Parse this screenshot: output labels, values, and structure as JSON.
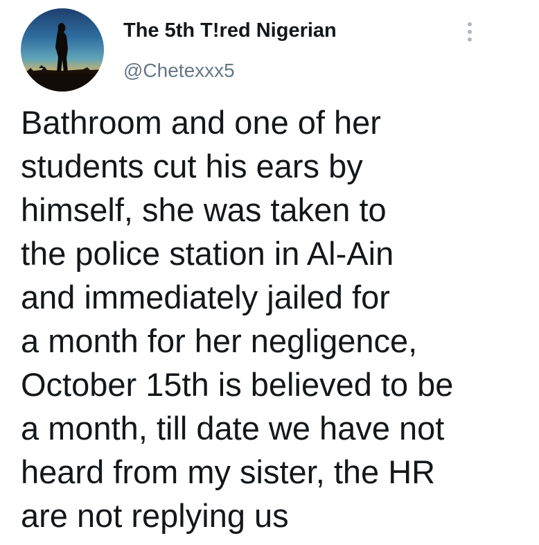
{
  "author": {
    "display_name": "The 5th T!red Nigerian",
    "handle": "@Chetexxx5",
    "avatar_icon": "silhouette-sunset-avatar"
  },
  "menu": {
    "icon": "more-vertical-icon"
  },
  "tweet": {
    "lines": [
      "Bathroom and one of her",
      "students cut his ears by",
      "himself, she was taken to",
      "the police station in Al-Ain",
      "and immediately jailed for",
      "a month for her negligence,",
      "October 15th is believed to be",
      "a month, till date we have not",
      "heard from my sister, the HR",
      "are not replying us"
    ]
  },
  "colors": {
    "text": "#14171a",
    "secondary": "#657786",
    "menu_dots": "#aab8c2"
  }
}
